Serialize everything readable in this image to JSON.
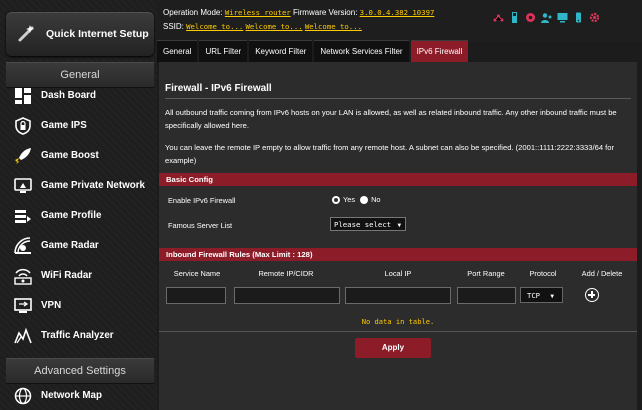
{
  "sidebar": {
    "quick_setup_label": "Quick Internet Setup",
    "general_title": "General",
    "advanced_title": "Advanced Settings",
    "items": [
      {
        "label": "Dash Board",
        "icon": "dashboard-icon"
      },
      {
        "label": "Game IPS",
        "icon": "lock-icon"
      },
      {
        "label": "Game Boost",
        "icon": "rocket-icon"
      },
      {
        "label": "Game Private Network",
        "icon": "monitor-icon"
      },
      {
        "label": "Game Profile",
        "icon": "profile-icon"
      },
      {
        "label": "Game Radar",
        "icon": "radar-icon"
      },
      {
        "label": "WiFi Radar",
        "icon": "wifi-radar-icon"
      },
      {
        "label": "VPN",
        "icon": "vpn-icon"
      },
      {
        "label": "Traffic Analyzer",
        "icon": "traffic-analyzer-icon"
      }
    ],
    "advanced_items": [
      {
        "label": "Network Map",
        "icon": "globe-icon"
      }
    ]
  },
  "header": {
    "op_mode_prefix": "Operation Mode:",
    "op_mode_value": "Wireless router",
    "fw_prefix": "Firmware Version:",
    "fw_value": "3.0.0.4.382_10397",
    "ssid_prefix": "SSID:",
    "ssid_values": [
      "Welcome to...",
      "Welcome to...",
      "Welcome to..."
    ]
  },
  "tabs": [
    "General",
    "URL Filter",
    "Keyword Filter",
    "Network Services Filter",
    "IPv6 Firewall"
  ],
  "active_tab": "IPv6 Firewall",
  "main": {
    "title": "Firewall - IPv6 Firewall",
    "desc1": "All outbound traffic coming from IPv6 hosts on your LAN is allowed, as well as related inbound traffic. Any other inbound traffic must be specifically allowed here.",
    "desc2": "You can leave the remote IP empty to allow traffic from any remote host. A subnet can also be specified. (2001::1111:2222:3333/64 for example)",
    "basic_config_title": "Basic Config",
    "enable_label": "Enable IPv6 Firewall",
    "yes_label": "Yes",
    "no_label": "No",
    "enable_value": "Yes",
    "server_list_label": "Famous Server List",
    "server_list_value": "Please select",
    "rules_title": "Inbound Firewall Rules (Max Limit : 128)",
    "columns": [
      "Service Name",
      "Remote IP/CIDR",
      "Local IP",
      "Port Range",
      "Protocol",
      "Add / Delete"
    ],
    "protocol_value": "TCP",
    "no_data": "No data in table.",
    "apply_label": "Apply"
  },
  "colors": {
    "accent": "#8c1c28",
    "highlight": "#ffcc00",
    "background": "#2c2c2c"
  }
}
